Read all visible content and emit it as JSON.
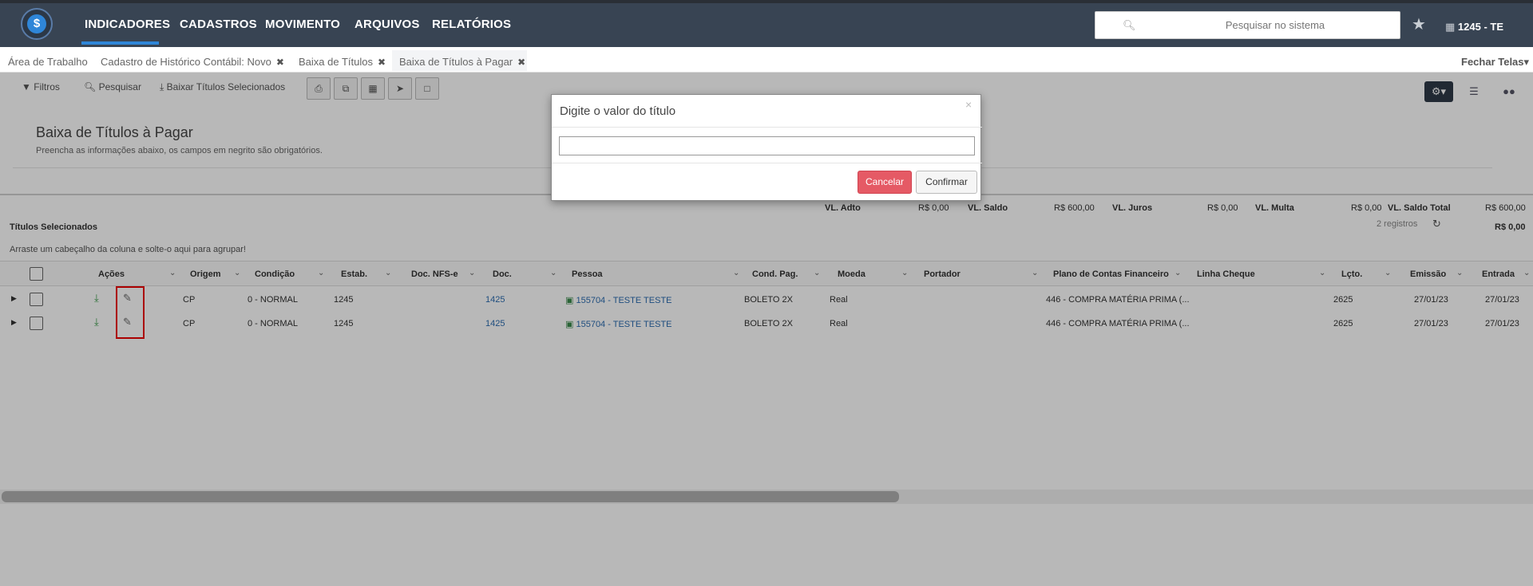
{
  "nav": {
    "logo_symbol": "$",
    "items": [
      "INDICADORES",
      "CADASTROS",
      "MOVIMENTO",
      "ARQUIVOS",
      "RELATÓRIOS"
    ],
    "active": "INDICADORES",
    "search_placeholder": "Pesquisar no sistema",
    "company": "1245 - TE"
  },
  "tabs": {
    "items": [
      {
        "label": "Área de Trabalho",
        "closable": false
      },
      {
        "label": "Cadastro de Histórico Contábil: Novo",
        "closable": true
      },
      {
        "label": "Baixa de Títulos",
        "closable": true
      },
      {
        "label": "Baixa de Títulos à Pagar",
        "closable": true,
        "active": true
      }
    ],
    "close_symbol": "✖",
    "close_all": "Fechar Telas"
  },
  "toolbar": {
    "filtros": "Filtros",
    "pesquisar": "Pesquisar",
    "baixar": "Baixar Títulos Selecionados"
  },
  "page": {
    "title": "Baixa de Títulos à Pagar",
    "subtitle": "Preencha as informações abaixo, os campos em negrito são obrigatórios."
  },
  "summary": {
    "vl_adto_label": "VL. Adto",
    "vl_adto": "R$ 0,00",
    "vl_saldo_label": "VL. Saldo",
    "vl_saldo": "R$ 600,00",
    "vl_juros_label": "VL. Juros",
    "vl_juros": "R$ 0,00",
    "vl_multa_label": "VL. Multa",
    "vl_multa": "R$ 0,00",
    "vl_saldo_total_label": "VL. Saldo Total",
    "vl_saldo_total": "R$ 600,00",
    "registros": "2 registros",
    "second_total": "R$ 0,00"
  },
  "grid": {
    "section_title": "Títulos Selecionados",
    "group_hint": "Arraste um cabeçalho da coluna e solte-o aqui para agrupar!",
    "columns": [
      "Ações",
      "Origem",
      "Condição",
      "Estab.",
      "Doc. NFS-e",
      "Doc.",
      "Pessoa",
      "Cond. Pag.",
      "Moeda",
      "Portador",
      "Plano de Contas Financeiro",
      "Linha Cheque",
      "Lçto.",
      "Emissão",
      "Entrada"
    ],
    "rows": [
      {
        "origem": "CP",
        "condicao": "0 - NORMAL",
        "estab": "1245",
        "doc": "1425",
        "pessoa": "155704 - TESTE TESTE",
        "cond_pag": "BOLETO 2X",
        "moeda": "Real",
        "plano": "446 - COMPRA MATÉRIA PRIMA (...",
        "lcto": "2625",
        "emissao": "27/01/23",
        "entrada": "27/01/23"
      },
      {
        "origem": "CP",
        "condicao": "0 - NORMAL",
        "estab": "1245",
        "doc": "1425",
        "pessoa": "155704 - TESTE TESTE",
        "cond_pag": "BOLETO 2X",
        "moeda": "Real",
        "plano": "446 - COMPRA MATÉRIA PRIMA (...",
        "lcto": "2625",
        "emissao": "27/01/23",
        "entrada": "27/01/23"
      }
    ]
  },
  "modal": {
    "title": "Digite o valor do título",
    "input_value": "",
    "cancel": "Cancelar",
    "confirm": "Confirmar",
    "close_symbol": "×"
  },
  "colors": {
    "nav_bg": "#384453",
    "accent": "#2f86d8",
    "cancel_bg": "#e55a65",
    "link": "#2c6cb0",
    "highlight": "#e00000"
  }
}
